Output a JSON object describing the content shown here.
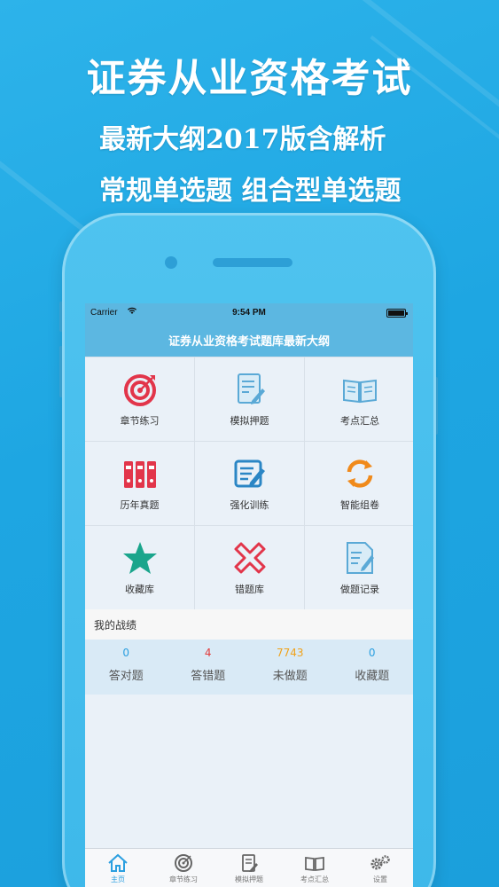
{
  "promo": {
    "title": "证券从业资格考试",
    "line1": "最新大纲2017版含解析",
    "line2": "常规单选题 组合型单选题"
  },
  "status_bar": {
    "carrier": "Carrier",
    "time": "9:54 PM"
  },
  "nav": {
    "title": "证券从业资格考试题库最新大纲"
  },
  "grid": [
    {
      "label": "章节练习",
      "icon": "target-icon"
    },
    {
      "label": "模拟押题",
      "icon": "document-pen-icon"
    },
    {
      "label": "考点汇总",
      "icon": "open-book-icon"
    },
    {
      "label": "历年真题",
      "icon": "binders-icon"
    },
    {
      "label": "强化训练",
      "icon": "notepad-pencil-icon"
    },
    {
      "label": "智能组卷",
      "icon": "refresh-icon"
    },
    {
      "label": "收藏库",
      "icon": "star-icon"
    },
    {
      "label": "错题库",
      "icon": "cross-icon"
    },
    {
      "label": "做题记录",
      "icon": "record-icon"
    }
  ],
  "scores": {
    "title": "我的战绩",
    "items": [
      {
        "value": "0",
        "label": "答对题",
        "color": "#2b9fe0"
      },
      {
        "value": "4",
        "label": "答错题",
        "color": "#e23b3b"
      },
      {
        "value": "7743",
        "label": "未做题",
        "color": "#f0a21b"
      },
      {
        "value": "0",
        "label": "收藏题",
        "color": "#2b9fe0"
      }
    ]
  },
  "tabs": [
    {
      "label": "主页",
      "icon": "home-icon",
      "active": true
    },
    {
      "label": "章节练习",
      "icon": "target-icon"
    },
    {
      "label": "模拟押题",
      "icon": "document-pen-icon"
    },
    {
      "label": "考点汇总",
      "icon": "open-book-icon"
    },
    {
      "label": "设置",
      "icon": "gear-icon"
    }
  ],
  "colors": {
    "background": "#1ea6e2",
    "nav": "#5cb7e1",
    "accent_red": "#e23b3b",
    "accent_teal": "#1aa58c",
    "accent_orange": "#f08a1b"
  }
}
